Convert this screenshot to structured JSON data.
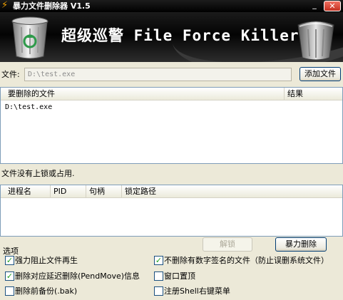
{
  "window": {
    "title": "暴力文件删除器 V1.5",
    "minimize_glyph": "_",
    "close_glyph": "✕"
  },
  "banner": {
    "title": "超级巡警 File Force Killer",
    "icons": [
      "recycle-bin-icon",
      "trash-can-icon"
    ]
  },
  "file_row": {
    "label": "文件:",
    "value": "D:\\test.exe",
    "add_button": "添加文件"
  },
  "file_list": {
    "columns": [
      "要删除的文件",
      "结果"
    ],
    "rows": [
      {
        "file": "D:\\test.exe",
        "result": ""
      }
    ]
  },
  "status_text": "文件没有上锁或占用.",
  "process_list": {
    "columns": [
      "进程名",
      "PID",
      "句柄",
      "锁定路径"
    ],
    "rows": []
  },
  "actions": {
    "unlock": "解锁",
    "force_delete": "暴力删除"
  },
  "options": {
    "label": "选项",
    "items": [
      {
        "label": "强力阻止文件再生",
        "checked": true
      },
      {
        "label": "不删除有数字签名的文件（防止误删系统文件）",
        "checked": true
      },
      {
        "label": "删除对应延迟删除(PendMove)信息",
        "checked": true
      },
      {
        "label": "窗口置顶",
        "checked": false
      },
      {
        "label": "删除前备份(.bak)",
        "checked": false
      },
      {
        "label": "注册Shell右键菜单",
        "checked": false
      }
    ]
  },
  "colors": {
    "accent": "#003c74",
    "window_bg": "#ece9d8",
    "check_mark": "#21a121"
  }
}
